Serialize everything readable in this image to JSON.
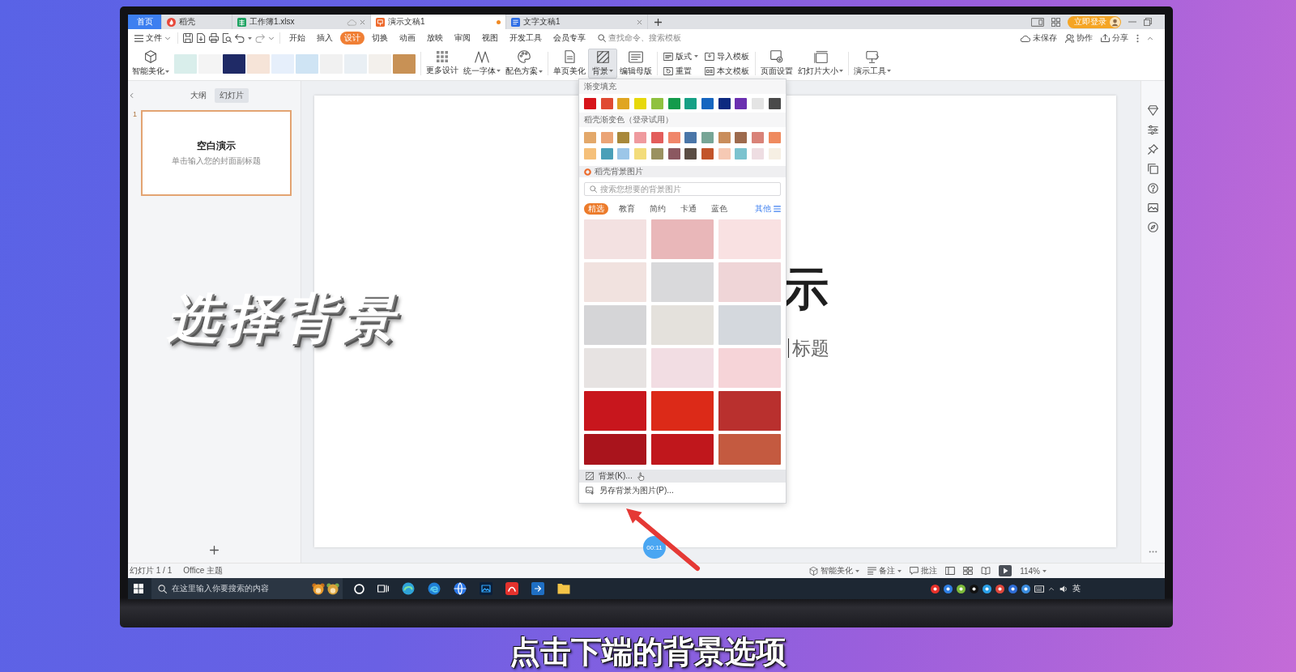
{
  "tabs": [
    {
      "kind": "home",
      "label": "首页",
      "selected": false,
      "modified": false,
      "closable": false,
      "cloud": false
    },
    {
      "kind": "docer",
      "label": "稻壳",
      "selected": false,
      "modified": false,
      "closable": false,
      "cloud": false
    },
    {
      "kind": "sheet",
      "label": "工作簿1.xlsx",
      "selected": false,
      "modified": false,
      "closable": true,
      "cloud": true
    },
    {
      "kind": "slides",
      "label": "演示文稿1",
      "selected": true,
      "modified": true,
      "closable": false,
      "cloud": false
    },
    {
      "kind": "writer",
      "label": "文字文稿1",
      "selected": false,
      "modified": false,
      "closable": true,
      "cloud": false
    }
  ],
  "login": {
    "label": "立即登录"
  },
  "file_menu": {
    "label": "文件"
  },
  "menu_tabs": [
    {
      "label": "开始",
      "selected": false
    },
    {
      "label": "插入",
      "selected": false
    },
    {
      "label": "设计",
      "selected": true
    },
    {
      "label": "切换",
      "selected": false
    },
    {
      "label": "动画",
      "selected": false
    },
    {
      "label": "放映",
      "selected": false
    },
    {
      "label": "审阅",
      "selected": false
    },
    {
      "label": "视图",
      "selected": false
    },
    {
      "label": "开发工具",
      "selected": false
    },
    {
      "label": "会员专享",
      "selected": false
    }
  ],
  "command_search": {
    "placeholder": "查找命令、搜索模板"
  },
  "menu_actions": [
    {
      "label": "未保存"
    },
    {
      "label": "协作"
    },
    {
      "label": "分享"
    }
  ],
  "ribbon": {
    "beautify": {
      "label": "智能美化",
      "dropdown": true
    },
    "templates": [
      {
        "color": "#d9eeeb"
      },
      {
        "color": "#f4f4f4"
      },
      {
        "color": "#1f2a66"
      },
      {
        "color": "#f6e4d8"
      },
      {
        "color": "#e6effb"
      },
      {
        "color": "#cfe4f4"
      },
      {
        "color": "#f1f1f1"
      },
      {
        "color": "#e9eff4"
      },
      {
        "color": "#f3f0ec"
      },
      {
        "color": "#c89155"
      }
    ],
    "design_tools": [
      {
        "label": "更多设计",
        "dropdown": false
      },
      {
        "label": "统一字体",
        "dropdown": true
      },
      {
        "label": "配色方案",
        "dropdown": true
      }
    ],
    "page_tools": [
      {
        "label": "单页美化",
        "dropdown": false,
        "pressed": false
      },
      {
        "label": "背景",
        "dropdown": true,
        "pressed": true
      },
      {
        "label": "编辑母版",
        "dropdown": false,
        "pressed": false
      }
    ],
    "layout_pairs": [
      {
        "label": "版式",
        "dropdown": true
      },
      {
        "label": "重置",
        "dropdown": false
      },
      {
        "label": "导入模板",
        "dropdown": false
      },
      {
        "label": "本文模板",
        "dropdown": false
      }
    ],
    "setup_tools": [
      {
        "label": "页面设置",
        "dropdown": false
      },
      {
        "label": "幻灯片大小",
        "dropdown": true
      }
    ],
    "presenter": {
      "label": "演示工具",
      "dropdown": true
    }
  },
  "outline_tabs": [
    {
      "label": "大纲",
      "selected": false
    },
    {
      "label": "幻灯片",
      "selected": true
    }
  ],
  "slides": [
    {
      "number": "1",
      "title": "空白演示",
      "subtitle": "单击输入您的封面副标题",
      "selected": true
    }
  ],
  "slide": {
    "title": "示",
    "subtitle": "标题"
  },
  "background_menu": {
    "gradient_title": "渐变填充",
    "gradient_swatches": [
      {
        "color": "#d7141a"
      },
      {
        "color": "#e04a32"
      },
      {
        "color": "#e0a521"
      },
      {
        "color": "#e7d80a"
      },
      {
        "color": "#8fc13f"
      },
      {
        "color": "#139b4b"
      },
      {
        "color": "#16a085"
      },
      {
        "color": "#1565c0"
      },
      {
        "color": "#0d2a80"
      },
      {
        "color": "#6a2fb0"
      },
      {
        "color": "#e4e4e4"
      },
      {
        "color": "#4a4a4a"
      }
    ],
    "docer_title": "稻壳渐变色（登录试用）",
    "docer_swatches": [
      {
        "color": "#e3a86a"
      },
      {
        "color": "#eba476"
      },
      {
        "color": "#a8883a"
      },
      {
        "color": "#ef9a9e"
      },
      {
        "color": "#e35d5b"
      },
      {
        "color": "#f0866a"
      },
      {
        "color": "#4a76a8"
      },
      {
        "color": "#77a596"
      },
      {
        "color": "#c98d5b"
      },
      {
        "color": "#9d6a4d"
      },
      {
        "color": "#d98278"
      },
      {
        "color": "#ef8a5e"
      },
      {
        "color": "#f5c07a"
      },
      {
        "color": "#4a9fb8"
      },
      {
        "color": "#9cc6e8"
      },
      {
        "color": "#f3dc7a"
      },
      {
        "color": "#9a9160"
      },
      {
        "color": "#8b5860"
      },
      {
        "color": "#5a4d44"
      },
      {
        "color": "#c2542a"
      },
      {
        "color": "#f6c9b4"
      },
      {
        "color": "#7cc3cf"
      },
      {
        "color": "#eedde2"
      },
      {
        "color": "#f6efe3"
      }
    ],
    "images_title": "稻壳背景图片",
    "search": {
      "placeholder": "搜索您想要的背景图片"
    },
    "categories": [
      {
        "label": "精选",
        "selected": true
      },
      {
        "label": "教育",
        "selected": false
      },
      {
        "label": "简约",
        "selected": false
      },
      {
        "label": "卡通",
        "selected": false
      },
      {
        "label": "蓝色",
        "selected": false
      }
    ],
    "more": "其他",
    "images": [
      {
        "color": "#f3e1e1"
      },
      {
        "color": "#e9b7b9"
      },
      {
        "color": "#f9e1e2"
      },
      {
        "color": "#f1e2df"
      },
      {
        "color": "#d9d9db"
      },
      {
        "color": "#efd5d7"
      },
      {
        "color": "#d5d5d7"
      },
      {
        "color": "#e4e1dc"
      },
      {
        "color": "#d4d8dd"
      },
      {
        "color": "#e7e3e2"
      },
      {
        "color": "#f2dde3"
      },
      {
        "color": "#f6d4d8"
      },
      {
        "color": "#c8161d"
      },
      {
        "color": "#dc2a18"
      },
      {
        "color": "#b9302e"
      },
      {
        "color": "#a9141c"
      },
      {
        "color": "#c0171c"
      },
      {
        "color": "#c45a40"
      }
    ],
    "actions": [
      {
        "label": "背景(K)...",
        "hovered": true
      },
      {
        "label": "另存背景为图片(P)...",
        "hovered": false
      }
    ]
  },
  "status_bar": {
    "slide_count": "幻灯片 1 / 1",
    "theme": "Office 主题",
    "beautify": "智能美化",
    "notes": "备注",
    "comments": "批注",
    "zoom": "114%"
  },
  "taskbar": {
    "search": {
      "placeholder": "在这里输入你要搜索的内容"
    },
    "input_method": "英"
  },
  "timer": "00:11",
  "overlay_title": "选择背景",
  "caption": "点击下端的背景选项"
}
